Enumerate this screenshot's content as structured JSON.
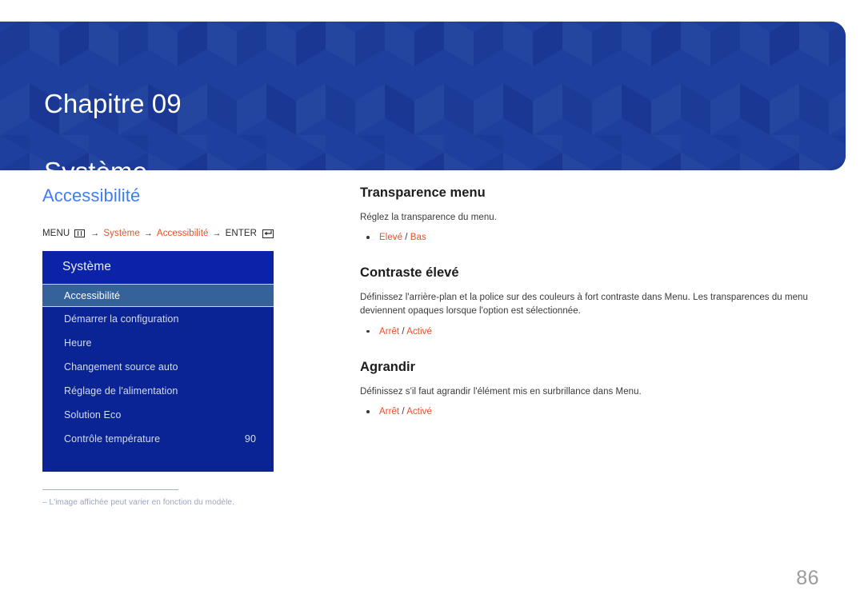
{
  "banner": {
    "chapter_label": "Chapitre 09",
    "chapter_title": "Système",
    "bg_color": "#1e3f9e"
  },
  "left": {
    "section_heading": "Accessibilité",
    "heading_color": "#3d7ef0",
    "breadcrumb": {
      "menu_label": "MENU",
      "menu_icon": "menu-grid-icon",
      "arrow1": "→",
      "path1": "Système",
      "arrow2": "→",
      "path2": "Accessibilité",
      "arrow3": "→",
      "enter_label": "ENTER",
      "enter_icon": "enter-return-icon",
      "accent_color": "#e8502a"
    },
    "osd": {
      "title": "Système",
      "items": [
        {
          "label": "Accessibilité",
          "value": "",
          "selected": true
        },
        {
          "label": "Démarrer la configuration",
          "value": "",
          "selected": false
        },
        {
          "label": "Heure",
          "value": "",
          "selected": false
        },
        {
          "label": "Changement source auto",
          "value": "",
          "selected": false
        },
        {
          "label": "Réglage de l'alimentation",
          "value": "",
          "selected": false
        },
        {
          "label": "Solution Eco",
          "value": "",
          "selected": false
        },
        {
          "label": "Contrôle température",
          "value": "90",
          "selected": false
        }
      ],
      "bg_color": "#0a2496",
      "selected_color": "#36629b"
    },
    "footnote": "–  L'image affichée peut varier en fonction du modèle."
  },
  "right": {
    "topics": [
      {
        "title": "Transparence menu",
        "description": "Réglez la transparence du menu.",
        "options": [
          {
            "first": "Elevé",
            "separator": " / ",
            "second": "Bas"
          }
        ]
      },
      {
        "title": "Contraste élevé",
        "description": "Définissez l'arrière-plan et la police sur des couleurs à fort contraste dans Menu. Les transparences du menu deviennent opaques lorsque l'option est sélectionnée.",
        "options": [
          {
            "first": "Arrêt",
            "separator": " / ",
            "second": "Activé"
          }
        ]
      },
      {
        "title": "Agrandir",
        "description": "Définissez s'il faut agrandir l'élément mis en surbrillance dans Menu.",
        "options": [
          {
            "first": "Arrêt",
            "separator": " / ",
            "second": "Activé"
          }
        ]
      }
    ]
  },
  "page_number": "86"
}
